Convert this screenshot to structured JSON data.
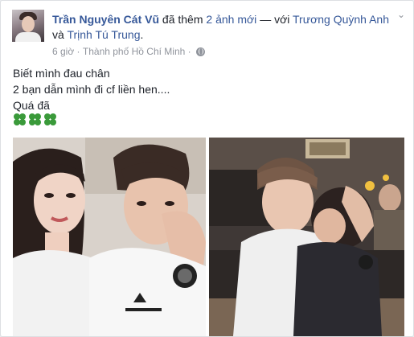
{
  "post": {
    "author": "Trần Nguyên Cát Vũ",
    "action": "đã thêm",
    "photos_link": "2 ảnh mới",
    "with_text": "— với",
    "tag1": "Trương Quỳnh Anh",
    "and_text": "và",
    "tag2": "Trịnh Tú Trung",
    "time": "6 giờ",
    "location": "Thành phố Hồ Chí Minh",
    "privacy_icon": "globe-icon",
    "lines": [
      "Biết mình đau chân",
      "2 bạn dẫn mình đi cf liền hen....",
      "Quá đã"
    ],
    "emoji_icon": "four-leaf-clover-icon",
    "colors": {
      "link": "#365899",
      "text": "#1d2129",
      "meta": "#90949c"
    }
  }
}
